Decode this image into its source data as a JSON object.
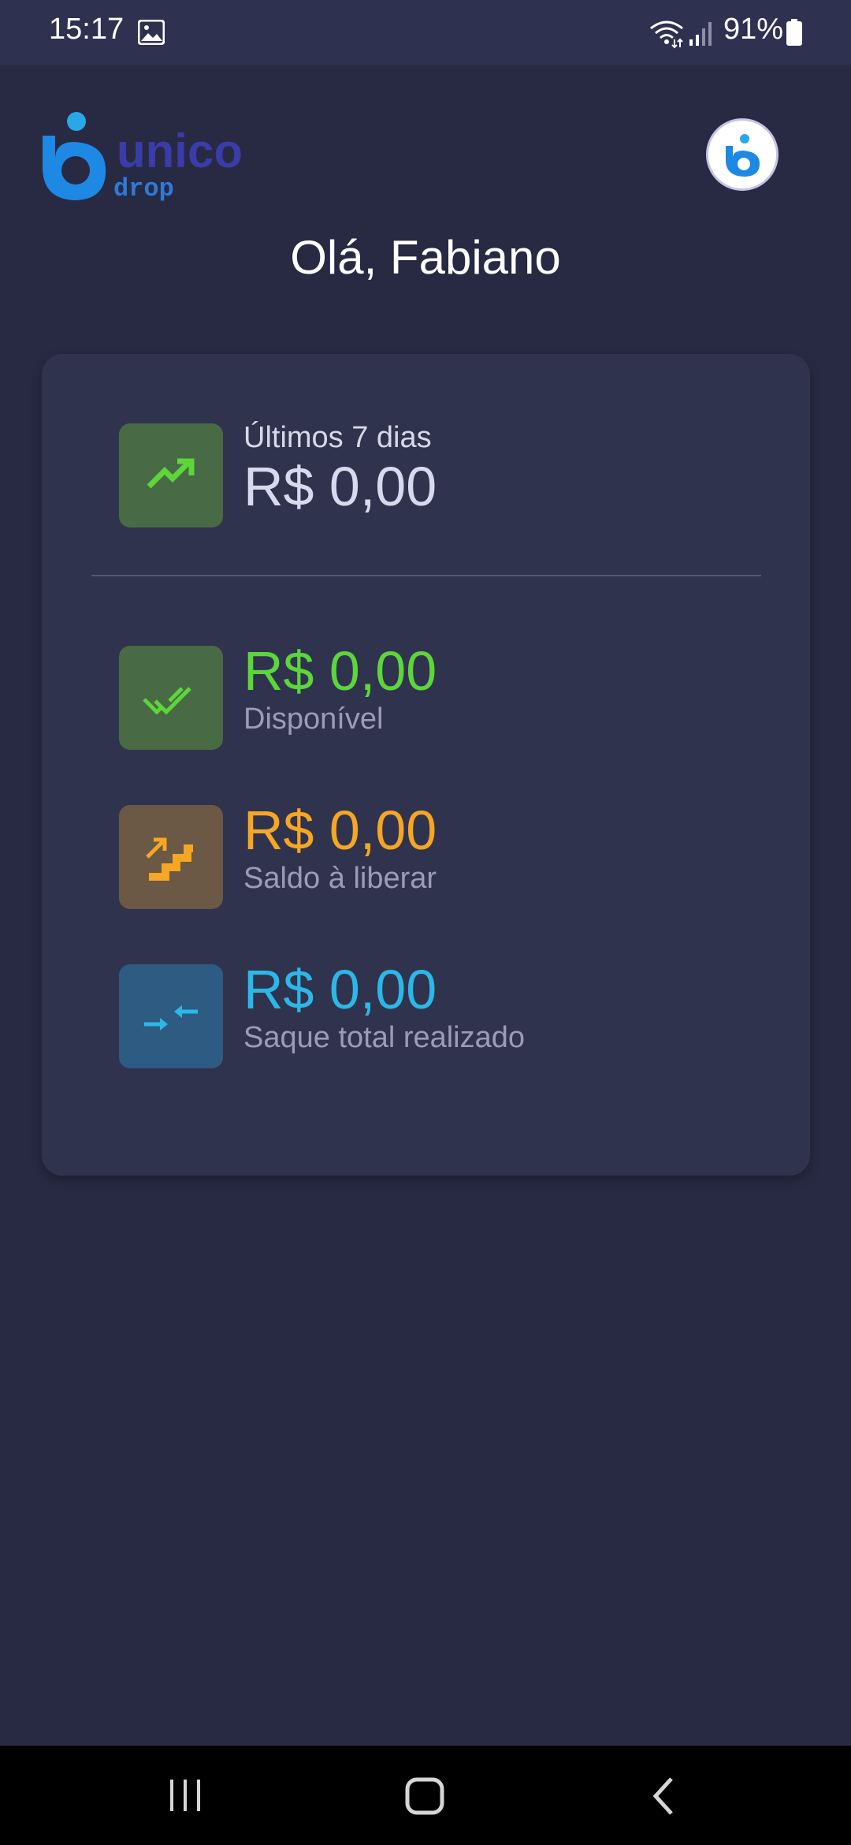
{
  "status_bar": {
    "time": "15:17",
    "battery": "91%",
    "icons": [
      "gallery-icon",
      "wifi-icon",
      "signal-icon",
      "battery-icon"
    ]
  },
  "header": {
    "logo": {
      "word": "unico",
      "sub": "drop"
    },
    "greeting": "Olá, Fabiano"
  },
  "summary": {
    "last7": {
      "label": "Últimos 7 dias",
      "value": "R$ 0,00",
      "icon": "trending-up-icon",
      "color": "#5cd63a",
      "bg": "#486a45"
    },
    "available": {
      "value": "R$ 0,00",
      "label": "Disponível",
      "icon": "double-check-icon",
      "color": "#5cd63a",
      "bg": "#486a45"
    },
    "to_release": {
      "value": "R$ 0,00",
      "label": "Saldo à liberar",
      "icon": "stairs-icon",
      "color": "#f5a623",
      "bg": "#6b5845"
    },
    "withdrawn": {
      "value": "R$ 0,00",
      "label": "Saque total realizado",
      "icon": "compare-arrows-icon",
      "color": "#2bb8e8",
      "bg": "#2d5b82"
    }
  },
  "colors": {
    "background": "#282943",
    "card": "#30334e",
    "brand_blue": "#1e88e5",
    "brand_navy": "#3a3ca8"
  }
}
